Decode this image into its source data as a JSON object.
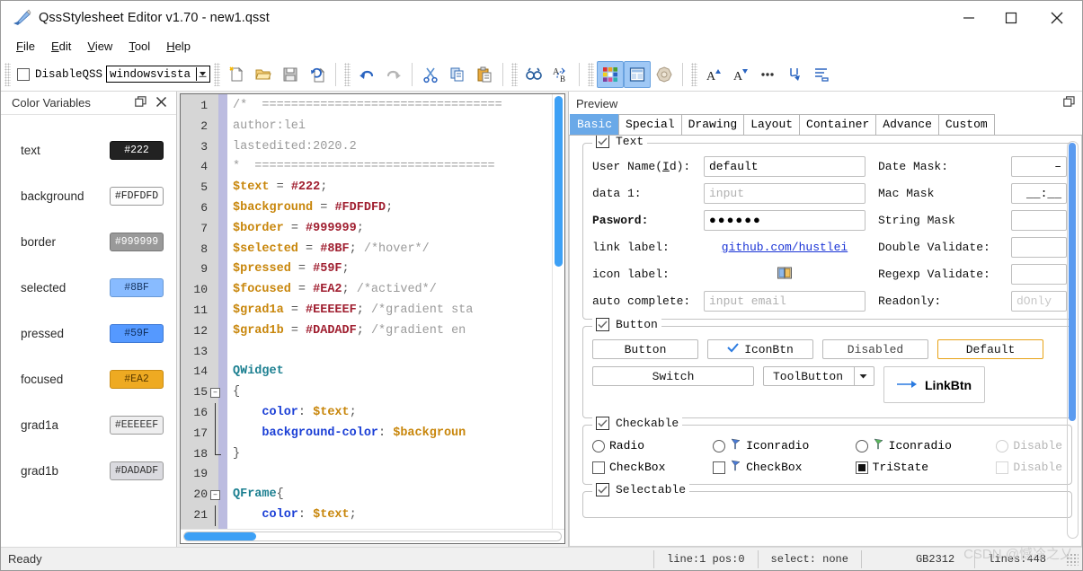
{
  "window": {
    "title": "QssStylesheet Editor v1.70 - new1.qsst",
    "minimize": "–",
    "maximize": "□",
    "close": "✕"
  },
  "menubar": [
    {
      "label": "File",
      "mnemonic": "F"
    },
    {
      "label": "Edit",
      "mnemonic": "E"
    },
    {
      "label": "View",
      "mnemonic": "V"
    },
    {
      "label": "Tool",
      "mnemonic": "T"
    },
    {
      "label": "Help",
      "mnemonic": "H"
    }
  ],
  "toolbar": {
    "disable_qss_label": "DisableQSS",
    "style_combo_value": "windowsvista",
    "buttons": [
      {
        "name": "new-file-icon",
        "tip": "New"
      },
      {
        "name": "open-file-icon",
        "tip": "Open"
      },
      {
        "name": "save-file-icon",
        "tip": "Save"
      },
      {
        "name": "save-as-icon",
        "tip": "Save As"
      },
      {
        "name": "undo-icon",
        "tip": "Undo"
      },
      {
        "name": "redo-icon",
        "tip": "Redo"
      },
      {
        "name": "cut-icon",
        "tip": "Cut"
      },
      {
        "name": "copy-icon",
        "tip": "Copy"
      },
      {
        "name": "paste-icon",
        "tip": "Paste"
      },
      {
        "name": "find-icon",
        "tip": "Find"
      },
      {
        "name": "replace-icon",
        "tip": "Replace"
      },
      {
        "name": "color-palette-icon",
        "tip": "Color Variables"
      },
      {
        "name": "preview-panel-icon",
        "tip": "Preview"
      },
      {
        "name": "texture-icon",
        "tip": "Texture"
      },
      {
        "name": "font-increase-icon",
        "tip": "Font Bigger"
      },
      {
        "name": "font-decrease-icon",
        "tip": "Font Smaller"
      },
      {
        "name": "more-icon",
        "tip": "More"
      },
      {
        "name": "wrap-icon",
        "tip": "Wrap"
      },
      {
        "name": "indent-icon",
        "tip": "Indent"
      }
    ]
  },
  "color_dock": {
    "title": "Color Variables",
    "float_icon": "⧉",
    "close_icon": "✕",
    "rows": [
      {
        "name": "text",
        "value": "#222",
        "bg": "#222222",
        "fg": "#ffffff",
        "border": "#111111"
      },
      {
        "name": "background",
        "value": "#FDFDFD",
        "bg": "#fdfdfd",
        "fg": "#222222",
        "border": "#9a9a9a"
      },
      {
        "name": "border",
        "value": "#999999",
        "bg": "#999999",
        "fg": "#ffffff",
        "border": "#777777"
      },
      {
        "name": "selected",
        "value": "#8BF",
        "bg": "#88bbff",
        "fg": "#1b3a66",
        "border": "#6a9ad6"
      },
      {
        "name": "pressed",
        "value": "#59F",
        "bg": "#5599ff",
        "fg": "#10305e",
        "border": "#3f7ad6"
      },
      {
        "name": "focused",
        "value": "#EA2",
        "bg": "#eeaa22",
        "fg": "#5a3a00",
        "border": "#c98b12"
      },
      {
        "name": "grad1a",
        "value": "#EEEEEF",
        "bg": "#eeeeef",
        "fg": "#333333",
        "border": "#9a9a9a"
      },
      {
        "name": "grad1b",
        "value": "#DADADF",
        "bg": "#dadadf",
        "fg": "#333333",
        "border": "#9a9a9a"
      }
    ]
  },
  "editor": {
    "lines": [
      {
        "n": 1,
        "fold": "",
        "tokens": [
          {
            "t": "/*  =================================",
            "c": "cmt"
          }
        ]
      },
      {
        "n": 2,
        "fold": "",
        "tokens": [
          {
            "t": "author:lei",
            "c": "cmt"
          }
        ]
      },
      {
        "n": 3,
        "fold": "",
        "tokens": [
          {
            "t": "lastedited:2020.2",
            "c": "cmt"
          }
        ]
      },
      {
        "n": 4,
        "fold": "",
        "tokens": [
          {
            "t": "*  =================================",
            "c": "cmt"
          }
        ]
      },
      {
        "n": 5,
        "fold": "",
        "tokens": [
          {
            "t": "$text",
            "c": "var"
          },
          {
            "t": " = ",
            "c": "pun"
          },
          {
            "t": "#222",
            "c": "hex"
          },
          {
            "t": ";",
            "c": "pun"
          }
        ]
      },
      {
        "n": 6,
        "fold": "",
        "tokens": [
          {
            "t": "$background",
            "c": "var"
          },
          {
            "t": " = ",
            "c": "pun"
          },
          {
            "t": "#FDFDFD",
            "c": "hex"
          },
          {
            "t": ";",
            "c": "pun"
          }
        ]
      },
      {
        "n": 7,
        "fold": "",
        "tokens": [
          {
            "t": "$border",
            "c": "var"
          },
          {
            "t": " = ",
            "c": "pun"
          },
          {
            "t": "#999999",
            "c": "hex"
          },
          {
            "t": ";",
            "c": "pun"
          }
        ]
      },
      {
        "n": 8,
        "fold": "",
        "tokens": [
          {
            "t": "$selected",
            "c": "var"
          },
          {
            "t": " = ",
            "c": "pun"
          },
          {
            "t": "#8BF",
            "c": "hex"
          },
          {
            "t": "; ",
            "c": "pun"
          },
          {
            "t": "/*hover*/",
            "c": "cmt"
          }
        ]
      },
      {
        "n": 9,
        "fold": "",
        "tokens": [
          {
            "t": "$pressed",
            "c": "var"
          },
          {
            "t": " = ",
            "c": "pun"
          },
          {
            "t": "#59F",
            "c": "hex"
          },
          {
            "t": ";",
            "c": "pun"
          }
        ]
      },
      {
        "n": 10,
        "fold": "",
        "tokens": [
          {
            "t": "$focused",
            "c": "var"
          },
          {
            "t": " = ",
            "c": "pun"
          },
          {
            "t": "#EA2",
            "c": "hex"
          },
          {
            "t": "; ",
            "c": "pun"
          },
          {
            "t": "/*actived*/",
            "c": "cmt"
          }
        ]
      },
      {
        "n": 11,
        "fold": "",
        "tokens": [
          {
            "t": "$grad1a",
            "c": "var"
          },
          {
            "t": " = ",
            "c": "pun"
          },
          {
            "t": "#EEEEEF",
            "c": "hex"
          },
          {
            "t": "; ",
            "c": "pun"
          },
          {
            "t": "/*gradient sta",
            "c": "cmt"
          }
        ]
      },
      {
        "n": 12,
        "fold": "",
        "tokens": [
          {
            "t": "$grad1b",
            "c": "var"
          },
          {
            "t": " = ",
            "c": "pun"
          },
          {
            "t": "#DADADF",
            "c": "hex"
          },
          {
            "t": "; ",
            "c": "pun"
          },
          {
            "t": "/*gradient en",
            "c": "cmt"
          }
        ]
      },
      {
        "n": 13,
        "fold": "",
        "tokens": []
      },
      {
        "n": 14,
        "fold": "",
        "tokens": [
          {
            "t": "QWidget",
            "c": "sel"
          }
        ]
      },
      {
        "n": 15,
        "fold": "open",
        "tokens": [
          {
            "t": "{",
            "c": "pun"
          }
        ]
      },
      {
        "n": 16,
        "fold": "bar",
        "tokens": [
          {
            "t": "    ",
            "c": "pun"
          },
          {
            "t": "color",
            "c": "prop"
          },
          {
            "t": ": ",
            "c": "pun"
          },
          {
            "t": "$text",
            "c": "var"
          },
          {
            "t": ";",
            "c": "pun"
          }
        ]
      },
      {
        "n": 17,
        "fold": "bar",
        "tokens": [
          {
            "t": "    ",
            "c": "pun"
          },
          {
            "t": "background-color",
            "c": "prop"
          },
          {
            "t": ": ",
            "c": "pun"
          },
          {
            "t": "$backgroun",
            "c": "var"
          }
        ]
      },
      {
        "n": 18,
        "fold": "end",
        "tokens": [
          {
            "t": "}",
            "c": "pun"
          }
        ]
      },
      {
        "n": 19,
        "fold": "",
        "tokens": []
      },
      {
        "n": 20,
        "fold": "open",
        "tokens": [
          {
            "t": "QFrame",
            "c": "sel"
          },
          {
            "t": "{",
            "c": "pun"
          }
        ]
      },
      {
        "n": 21,
        "fold": "bar",
        "tokens": [
          {
            "t": "    ",
            "c": "pun"
          },
          {
            "t": "color",
            "c": "prop"
          },
          {
            "t": ": ",
            "c": "pun"
          },
          {
            "t": "$text",
            "c": "var"
          },
          {
            "t": ";",
            "c": "pun"
          }
        ]
      }
    ]
  },
  "preview": {
    "title": "Preview",
    "float_icon": "⧉",
    "tabs": [
      {
        "label": "Basic",
        "active": true
      },
      {
        "label": "Special",
        "active": false
      },
      {
        "label": "Drawing",
        "active": false
      },
      {
        "label": "Layout",
        "active": false
      },
      {
        "label": "Container",
        "active": false
      },
      {
        "label": "Advance",
        "active": false
      },
      {
        "label": "Custom",
        "active": false
      }
    ],
    "text_group": {
      "legend": "Text",
      "checked": true,
      "rows": [
        {
          "label": "User Name(Id):",
          "mnemonic": "I",
          "bold": false,
          "kind": "input",
          "value": "default",
          "placeholder": "",
          "right_label": "Date Mask:",
          "right_kind": "input",
          "right_value": "–",
          "right_align": "right"
        },
        {
          "label": "data 1:",
          "bold": false,
          "kind": "placeholder",
          "value": "",
          "placeholder": "input",
          "right_label": "Mac Mask",
          "right_kind": "input",
          "right_value": "__:__",
          "right_align": "right"
        },
        {
          "label": "Pasword:",
          "bold": true,
          "kind": "password",
          "value": "●●●●●●",
          "placeholder": "",
          "right_label": "String Mask",
          "right_kind": "input",
          "right_value": "",
          "right_align": "left"
        },
        {
          "label": "link label:",
          "bold": false,
          "kind": "link",
          "value": "github.com/hustlei",
          "placeholder": "",
          "right_label": "Double Validate:",
          "right_kind": "input",
          "right_value": "",
          "right_align": "left"
        },
        {
          "label": "icon label:",
          "bold": false,
          "kind": "icon",
          "value": "book-icon",
          "placeholder": "",
          "right_label": "Regexp Validate:",
          "right_kind": "input",
          "right_value": "",
          "right_align": "left"
        },
        {
          "label": "auto complete:",
          "bold": false,
          "kind": "placeholder",
          "value": "",
          "placeholder": "input email",
          "right_label": "Readonly:",
          "right_kind": "disabled",
          "right_value": "dOnly",
          "right_align": "left"
        }
      ]
    },
    "button_group": {
      "legend": "Button",
      "checked": true,
      "row1": [
        {
          "label": "Button",
          "style": "normal",
          "icon": ""
        },
        {
          "label": "IconBtn",
          "style": "normal",
          "icon": "check-icon"
        },
        {
          "label": "Disabled",
          "style": "disabled",
          "icon": ""
        },
        {
          "label": "Default",
          "style": "default",
          "icon": ""
        }
      ],
      "row2": {
        "switch": "Switch",
        "toolbutton": "ToolButton",
        "toolbutton_arrow": "▼",
        "linkbtn": "LinkBtn",
        "linkbtn_icon": "arrow-right-icon"
      }
    },
    "checkable_group": {
      "legend": "Checkable",
      "checked": true,
      "radios": [
        {
          "label": "Radio",
          "icon": "",
          "disabled": false
        },
        {
          "label": "Iconradio",
          "icon": "blue-flag-icon",
          "disabled": false
        },
        {
          "label": "Iconradio",
          "icon": "green-flag-icon",
          "disabled": false
        },
        {
          "label": "Disable",
          "icon": "",
          "disabled": true
        }
      ],
      "checkboxes": [
        {
          "label": "CheckBox",
          "icon": "",
          "state": "unchecked",
          "disabled": false
        },
        {
          "label": "CheckBox",
          "icon": "blue-flag-icon",
          "state": "unchecked",
          "disabled": false
        },
        {
          "label": "TriState",
          "icon": "",
          "state": "partial",
          "disabled": false
        },
        {
          "label": "Disable",
          "icon": "",
          "state": "unchecked",
          "disabled": true
        }
      ]
    },
    "selectable_group": {
      "legend": "Selectable",
      "checked": true
    }
  },
  "statusbar": {
    "ready": "Ready",
    "line": "line:1  pos:0",
    "select": "select: none",
    "encoding": "GB2312",
    "lines": "lines:448",
    "watermark": "CSDN @憾冷之乂"
  }
}
